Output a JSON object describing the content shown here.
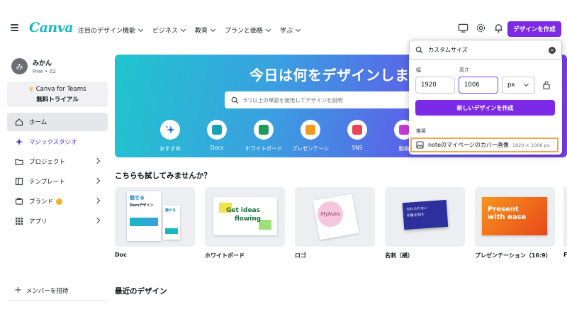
{
  "header": {
    "logo": "Canva",
    "nav": [
      "注目のデザイン機能",
      "ビジネス",
      "教育",
      "プランと価格",
      "学ぶ"
    ],
    "create_button": "デザインを作成"
  },
  "sidebar": {
    "user": {
      "avatar": "み",
      "name": "みかん",
      "plan": "Free • ♁2"
    },
    "teams": {
      "line1": "Canva for Teams",
      "line2": "無料トライアル"
    },
    "items": [
      {
        "label": "ホーム",
        "icon": "home-icon"
      },
      {
        "label": "マジックスタジオ",
        "icon": "sparkle-icon"
      },
      {
        "label": "プロジェクト",
        "icon": "folder-icon"
      },
      {
        "label": "テンプレート",
        "icon": "template-icon"
      },
      {
        "label": "ブランド",
        "icon": "brand-icon"
      },
      {
        "label": "アプリ",
        "icon": "apps-icon"
      }
    ],
    "invite": "メンバーを招待"
  },
  "hero": {
    "title": "今日は何をデザインしまし",
    "search_placeholder": "5つ以上の単語を使用してデザインを説明",
    "categories": [
      "おすすめ",
      "Docs",
      "ホワイトボード",
      "プレゼンテーシ",
      "SNS",
      "動画"
    ]
  },
  "popup": {
    "search_value": "カスタムサイズ",
    "width_label": "幅",
    "height_label": "高さ",
    "width_value": "1920",
    "height_value": "1006",
    "unit": "px",
    "create_button": "新しいデザインを作成",
    "suggest_label": "推奨",
    "suggestion": {
      "name": "noteのマイページのカバー画像",
      "size": "1920 × 1006 px"
    }
  },
  "try_section": {
    "title": "こちらも試してみませんか？",
    "cards": [
      {
        "label": "Doc",
        "thumb_text_1": "魅せる",
        "thumb_text_2": "Docsデザイン"
      },
      {
        "label": "ホワイトボード",
        "thumb_text_1": "Get ideas",
        "thumb_text_2": "flowing"
      },
      {
        "label": "ロゴ",
        "thumb_text_1": "MyNails"
      },
      {
        "label": "名刺（横）",
        "thumb_text_1": "忘れられない",
        "thumb_text_2": "印象を残す"
      },
      {
        "label": "プレゼンテーション（16:9）",
        "thumb_text_1": "Present",
        "thumb_text_2": "with ease"
      }
    ],
    "partial_label": "F"
  },
  "recent_section": {
    "title": "最近のデザイン"
  },
  "colors": {
    "brand_purple": "#7d2ae8",
    "logo_teal": "#18b9c6",
    "highlight_orange": "#f0a850"
  }
}
